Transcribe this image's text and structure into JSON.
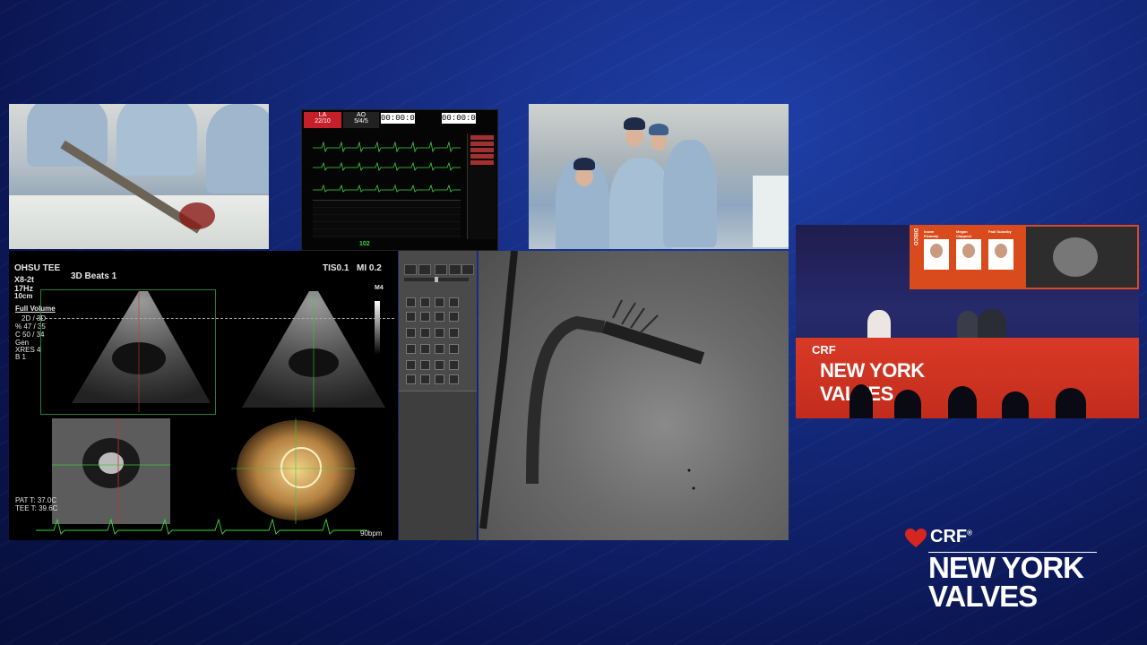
{
  "monitor": {
    "la_label": "LA",
    "la_value": "22/10",
    "ao_label": "AO",
    "ao_value": "5/4/5",
    "timer1": "00:00:00",
    "timer2": "00:00:00",
    "bottom_value": "102"
  },
  "echo": {
    "title": "OHSU TEE",
    "probe": "X8-2t",
    "freq": "17Hz",
    "depth": "10cm",
    "mode_header": "3D Beats 1",
    "tis": "TIS0.1",
    "mi": "MI 0.2",
    "mode": "Full Volume",
    "dims": "2D / 3D",
    "pct": "% 47 / 35",
    "c": "C  50 / 34",
    "gen": "Gen",
    "xres": "XRES 4",
    "b": "B 1",
    "m4": "M4",
    "pat_t": "PAT T: 37.0C",
    "tee_t": "TEE T: 39.6C",
    "bpm": "90bpm"
  },
  "studio": {
    "screen_label": "DISCO",
    "speakers": [
      {
        "name": "Issam Elzanaty"
      },
      {
        "name": "Megan Ciapponi"
      },
      {
        "name": "Fadi Sulaeiby"
      }
    ],
    "desk_brand": "CRF",
    "desk_title_line1": "NEW YORK",
    "desk_title_line2": "VALVES"
  },
  "logo": {
    "brand": "CRF",
    "registered": "®",
    "title_line1": "NEW YORK",
    "title_line2": "VALVES"
  },
  "colors": {
    "crf_red": "#d5261f",
    "background_blue": "#14287a"
  }
}
